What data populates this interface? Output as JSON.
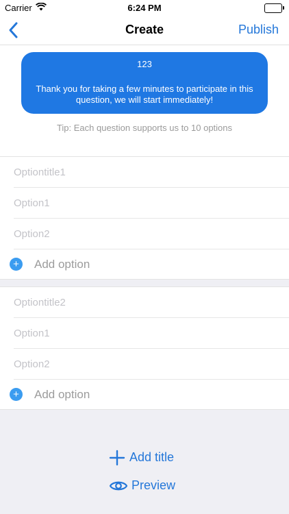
{
  "status_bar": {
    "carrier": "Carrier",
    "time": "6:24 PM"
  },
  "nav": {
    "title": "Create",
    "publish_label": "Publish",
    "back_icon": "chevron-left-icon"
  },
  "question": {
    "title": "123",
    "description": "Thank you for taking a few minutes to participate in this question, we will start immediately!",
    "tip": "Tip: Each question supports us to 10 options"
  },
  "groups": [
    {
      "title_placeholder": "Optiontitle1",
      "options": [
        "Option1",
        "Option2"
      ],
      "add_option_label": "Add option"
    },
    {
      "title_placeholder": "Optiontitle2",
      "options": [
        "Option1",
        "Option2"
      ],
      "add_option_label": "Add option"
    }
  ],
  "actions": {
    "add_title_label": "Add title",
    "preview_label": "Preview"
  },
  "colors": {
    "accent": "#2477d9",
    "bubble": "#1f78e3",
    "add_icon": "#3b9cf0",
    "background": "#efeff4"
  }
}
